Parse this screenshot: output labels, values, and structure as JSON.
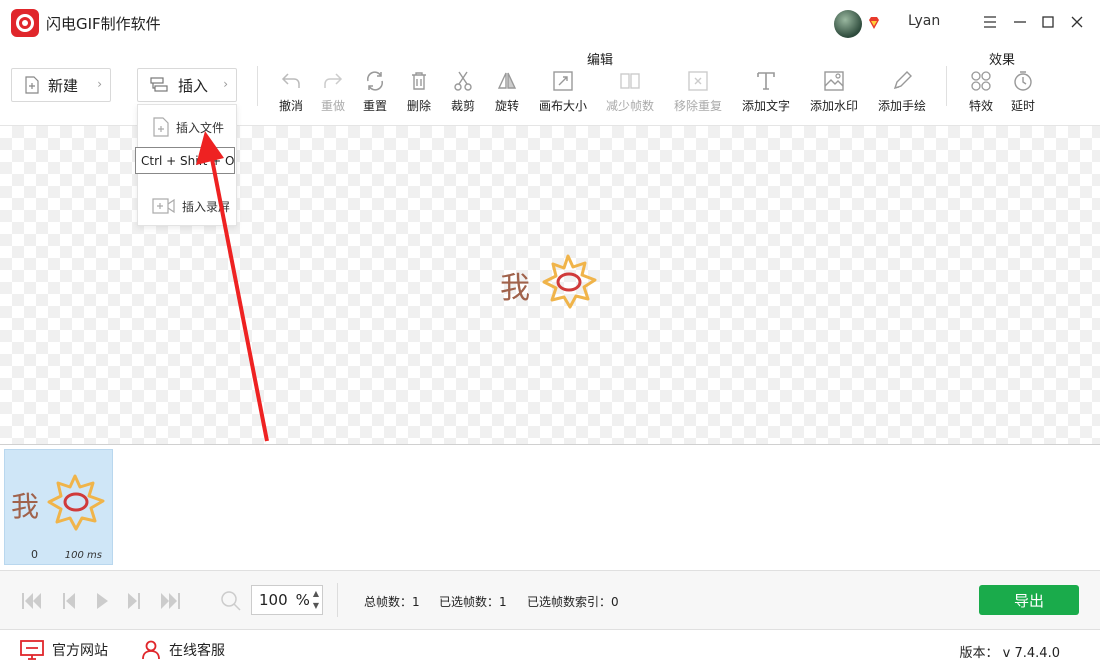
{
  "app": {
    "title": "闪电GIF制作软件",
    "username": "Lyan"
  },
  "toolbar": {
    "new_label": "新建",
    "insert_label": "插入",
    "group_edit": "编辑",
    "group_effects": "效果",
    "tools": {
      "undo": "撤消",
      "redo": "重做",
      "reset": "重置",
      "delete": "删除",
      "crop": "裁剪",
      "rotate": "旋转",
      "canvas_size": "画布大小",
      "reduce_frames": "减少帧数",
      "remove_duplicate": "移除重复",
      "add_text": "添加文字",
      "add_watermark": "添加水印",
      "add_drawing": "添加手绘",
      "effects": "特效",
      "delay": "延时"
    }
  },
  "insert_menu": {
    "items": [
      {
        "label": "插入文件"
      },
      {
        "label": "插入录屏"
      }
    ],
    "tooltip": "Ctrl + Shift + O"
  },
  "canvas": {
    "art_text": "我"
  },
  "frames": [
    {
      "index": "0",
      "duration": "100 ms"
    }
  ],
  "player": {
    "zoom": "100",
    "zoom_unit": "%",
    "total_frames": "总帧数：1",
    "selected_frames": "已选帧数：1",
    "selected_index": "已选帧数索引：0",
    "export_label": "导出"
  },
  "footer": {
    "website": "官方网站",
    "support": "在线客服",
    "version": "版本： v 7.4.4.0"
  },
  "colors": {
    "brand": "#e0262b",
    "export": "#1aab4b",
    "frame_selected": "#cfe6f7"
  }
}
